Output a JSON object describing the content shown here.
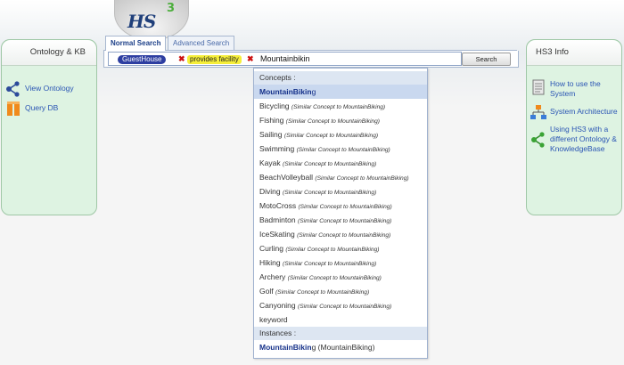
{
  "logo": {
    "text": "HS",
    "sup": "3"
  },
  "left_panel": {
    "title": "Ontology & KB",
    "items": [
      {
        "label": "View Ontology",
        "icon": "share-network-icon"
      },
      {
        "label": "Query DB",
        "icon": "database-icon"
      }
    ]
  },
  "right_panel": {
    "title": "HS3 Info",
    "items": [
      {
        "label": "How to use the System",
        "icon": "manual-icon"
      },
      {
        "label": "System Architecture",
        "icon": "hierarchy-icon"
      },
      {
        "label": "Using HS3 with a different Ontology & KnowledgeBase",
        "icon": "share-network-icon"
      }
    ]
  },
  "tabs": [
    {
      "label": "Normal Search",
      "active": true
    },
    {
      "label": "Advanced Search",
      "active": false
    }
  ],
  "search": {
    "chips": [
      {
        "label": "GuestHouse"
      },
      {
        "label": "provides facility"
      }
    ],
    "typed": "Mountainbikin",
    "button": "Search"
  },
  "dropdown": {
    "concepts_header": "Concepts :",
    "selected": {
      "match": "MountainBikin",
      "rest": "g"
    },
    "similar_note": "(Similar Concept to MountainBiking)",
    "items": [
      "Bicycling",
      "Fishing",
      "Sailing",
      "Swimming",
      "Kayak",
      "BeachVolleyball",
      "Diving",
      "MotoCross",
      "Badminton",
      "IceSkating",
      "Curling",
      "Hiking",
      "Archery",
      "Golf",
      "Canyoning"
    ],
    "keyword": "keyword",
    "instances_header": "Instances :",
    "instance": {
      "match": "MountainBikin",
      "rest": "g",
      "note": " (MountainBiking)"
    }
  },
  "colors": {
    "panel_bg": "#def3e2",
    "link": "#2a55b4",
    "chip_guest": "#2d3ea1",
    "chip_prop": "#f5ee3a"
  }
}
